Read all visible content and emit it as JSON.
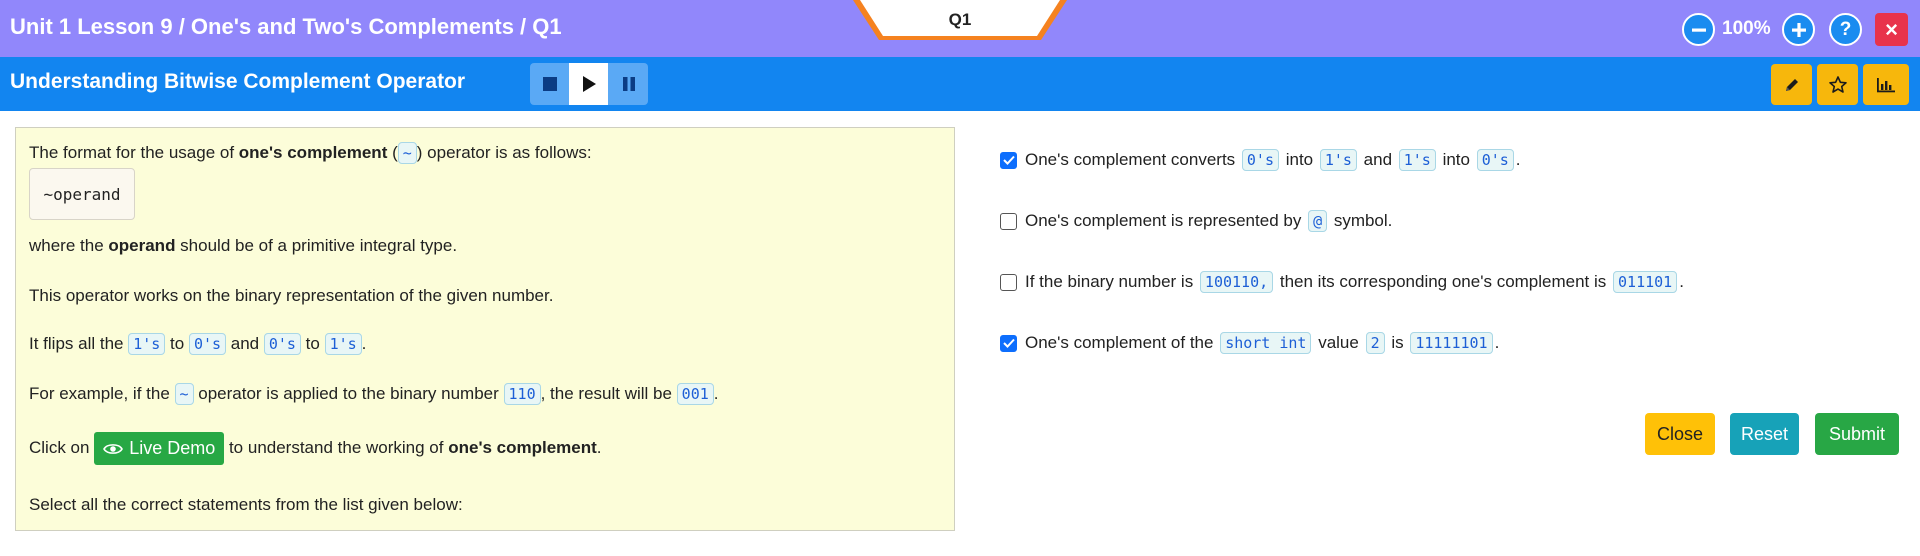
{
  "header": {
    "breadcrumb": "Unit 1 Lesson 9 / One's and Two's Complements / Q1",
    "question_tab": "Q1",
    "zoom_level": "100%",
    "icons": [
      "zoom-out-icon",
      "zoom-in-icon",
      "help-icon",
      "close-icon"
    ],
    "close_glyph": "×"
  },
  "toolbar": {
    "lesson_title": "Understanding Bitwise Complement Operator",
    "media_icons": [
      "stop-icon",
      "play-icon",
      "pause-icon"
    ],
    "tool_icons": [
      "pencil-icon",
      "star-icon",
      "chart-icon"
    ]
  },
  "content": {
    "p1_pre": "The format for the usage of ",
    "p1_bold": "one's complement",
    "p1_open": " (",
    "p1_code": "~",
    "p1_post": ") operator is as follows:",
    "code_block": "~operand",
    "p2_pre": "where the ",
    "p2_bold": "operand",
    "p2_post": " should be of a primitive integral type.",
    "p3": "This operator works on the binary representation of the given number.",
    "p4_a": "It flips all the ",
    "p4_c1": "1's",
    "p4_b": " to ",
    "p4_c2": "0's",
    "p4_c": " and ",
    "p4_c3": "0's",
    "p4_d": " to ",
    "p4_c4": "1's",
    "p4_e": ".",
    "p5_a": "For example, if the ",
    "p5_c1": "~",
    "p5_b": " operator is applied to the binary number ",
    "p5_c2": "110",
    "p5_c": ", the result will be ",
    "p5_c3": "001",
    "p5_d": ".",
    "p6_a": "Click on ",
    "live_demo_label": "Live Demo",
    "p6_b": " to understand the working of ",
    "p6_bold": "one's complement",
    "p6_c": ".",
    "p7": "Select all the correct statements from the list given below:"
  },
  "options": [
    {
      "checked": true,
      "t1": "One's complement converts ",
      "c1": "0's",
      "t2": " into ",
      "c2": "1's",
      "t3": " and ",
      "c3": "1's",
      "t4": " into ",
      "c4": "0's",
      "t5": "."
    },
    {
      "checked": false,
      "t1": "One's complement is represented by ",
      "c1": "@",
      "t2": " symbol."
    },
    {
      "checked": false,
      "t1": "If the binary number is ",
      "c1": "100110,",
      "t2": " then its corresponding one's complement is ",
      "c2": "011101",
      "t3": "."
    },
    {
      "checked": true,
      "t1": "One's complement of the ",
      "c1": "short int",
      "t2": " value ",
      "c2": "2",
      "t3": " is ",
      "c3": "11111101",
      "t4": "."
    }
  ],
  "actions": {
    "close_label": "Close",
    "reset_label": "Reset",
    "submit_label": "Submit"
  },
  "colors": {
    "header_bg": "#9187fb",
    "toolbar_bg": "#1285f0",
    "panel_bg": "#fcfdd9",
    "close_btn": "#ffc107",
    "reset_btn": "#17a2b8",
    "submit_btn": "#28a745",
    "live_demo": "#27a844"
  }
}
